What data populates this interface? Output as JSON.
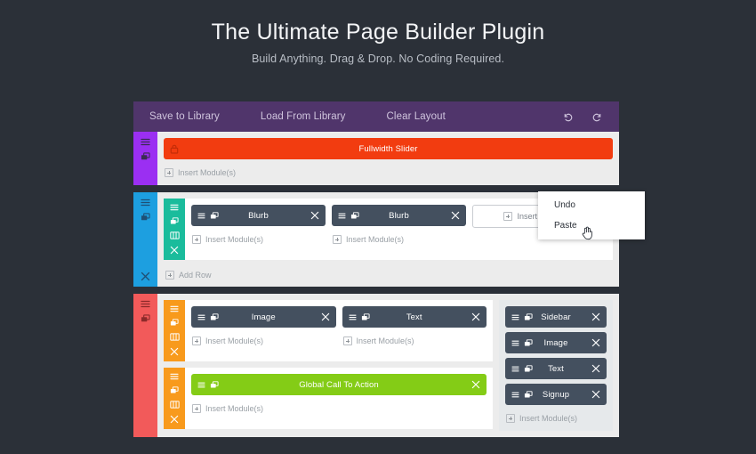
{
  "header": {
    "title": "The Ultimate Page Builder Plugin",
    "subtitle": "Build Anything. Drag & Drop. No Coding Required."
  },
  "toolbar": {
    "save_label": "Save to Library",
    "load_label": "Load From Library",
    "clear_label": "Clear Layout",
    "undo_icon": "undo-icon",
    "redo_icon": "redo-icon",
    "background": "#50356b"
  },
  "labels": {
    "insert_modules": "Insert Module(s)",
    "add_row": "Add Row"
  },
  "context_menu": {
    "visible": true,
    "items": [
      "Undo",
      "Paste"
    ],
    "undo": "Undo",
    "paste": "Paste"
  },
  "sections": [
    {
      "name": "fullwidth-section",
      "color": "#9b2ff2",
      "rows": [
        {
          "name": "fullwidth-row",
          "bar": false,
          "columns": [
            {
              "modules": [
                {
                  "label": "Fullwidth Slider",
                  "color": "#f23c10",
                  "locked": true
                }
              ],
              "insert": "Insert Module(s)"
            }
          ]
        }
      ]
    },
    {
      "name": "three-column-section",
      "color": "#1d9fe0",
      "add_row": "Add Row",
      "rows": [
        {
          "name": "blurb-row",
          "bar_color": "#1abc9c",
          "columns": [
            {
              "modules": [
                {
                  "label": "Blurb",
                  "color": "#44505f"
                }
              ],
              "insert": "Insert Module(s)"
            },
            {
              "modules": [
                {
                  "label": "Blurb",
                  "color": "#44505f"
                }
              ],
              "insert": "Insert Module(s)"
            },
            {
              "modules": [],
              "insert_box": "Insert Module(s)"
            }
          ]
        }
      ]
    },
    {
      "name": "content-sidebar-section",
      "color": "#f25a5a",
      "rows": [
        {
          "name": "image-text-row",
          "bar_color": "#f89a1c",
          "columns": [
            {
              "modules": [
                {
                  "label": "Image",
                  "color": "#44505f"
                }
              ],
              "insert": "Insert Module(s)"
            },
            {
              "modules": [
                {
                  "label": "Text",
                  "color": "#44505f"
                }
              ],
              "insert": "Insert Module(s)"
            }
          ]
        },
        {
          "name": "cta-row",
          "bar_color": "#f89a1c",
          "columns": [
            {
              "modules": [
                {
                  "label": "Global Call To Action",
                  "color": "#84cc16"
                }
              ],
              "insert": "Insert Module(s)"
            }
          ]
        }
      ],
      "sidebar_column": {
        "modules": [
          {
            "label": "Sidebar",
            "color": "#44505f"
          },
          {
            "label": "Image",
            "color": "#44505f"
          },
          {
            "label": "Text",
            "color": "#44505f"
          },
          {
            "label": "Signup",
            "color": "#44505f"
          }
        ],
        "insert": "Insert Module(s)"
      }
    }
  ],
  "icons": {
    "hamburger": "hamburger-icon",
    "clone": "clone-icon",
    "columns": "columns-icon",
    "close": "close-icon",
    "lock": "lock-icon"
  }
}
